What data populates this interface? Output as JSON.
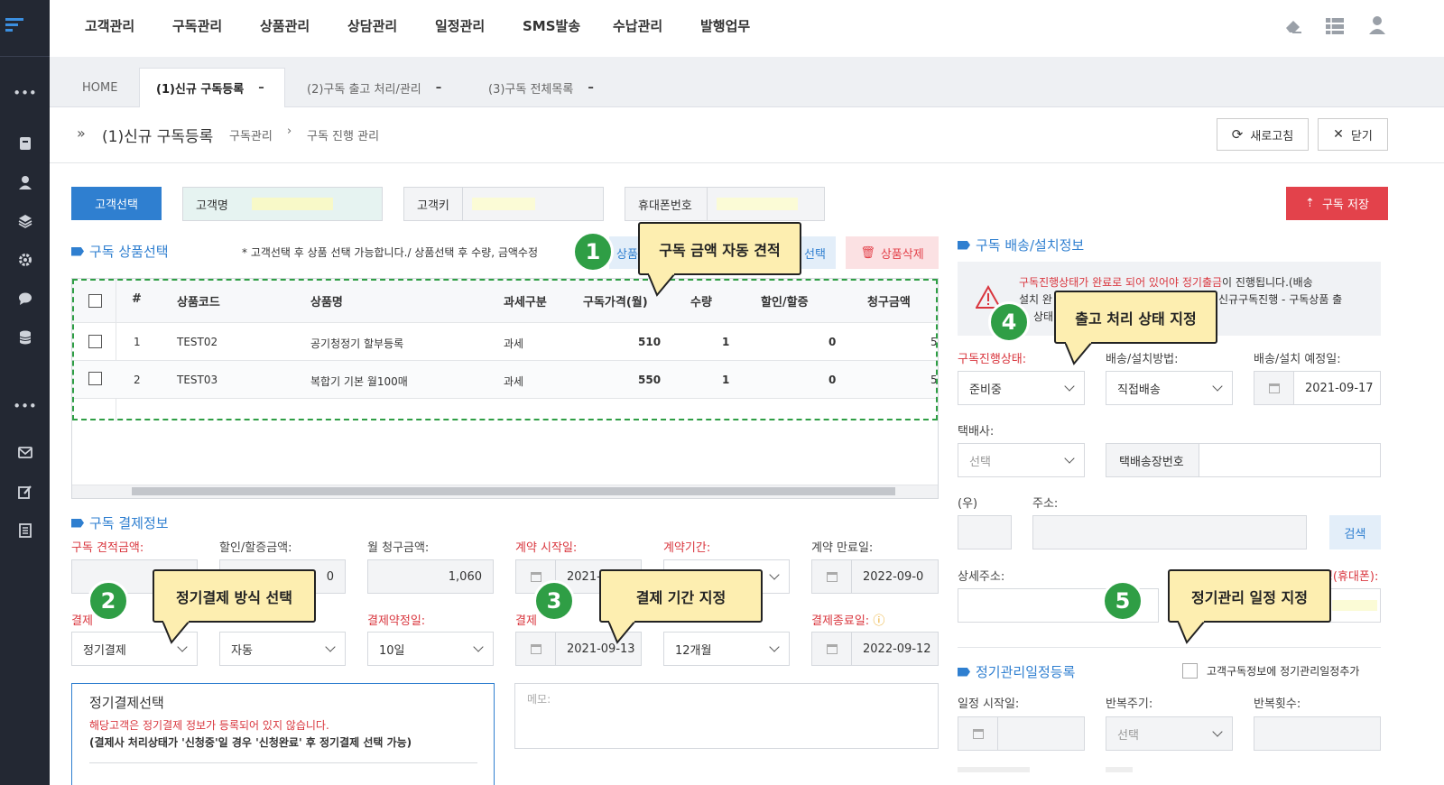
{
  "nav": {
    "menu": [
      "고객관리",
      "구독관리",
      "상품관리",
      "상담관리",
      "일정관리",
      "SMS발송",
      "수납관리",
      "발행업무"
    ]
  },
  "tabs": {
    "home": "HOME",
    "items": [
      {
        "label": "(1)신규 구독등록",
        "close": "–"
      },
      {
        "label": "(2)구독 출고 처리/관리",
        "close": "–"
      },
      {
        "label": "(3)구독 전체목록",
        "close": "–"
      }
    ]
  },
  "page": {
    "title": "(1)신규 구독등록",
    "breadcrumb": [
      "구독관리",
      "구독 진행 관리"
    ],
    "refresh": "새로고침",
    "close": "닫기",
    "save": "구독 저장"
  },
  "customer": {
    "select_btn": "고객선택",
    "name_label": "고객명",
    "key_label": "고객키",
    "phone_label": "휴대폰번호"
  },
  "products": {
    "section": "구독 상품선택",
    "note": "* 고객선택 후 상품 선택 가능합니다./ 상품선택 후 수량, 금액수정",
    "add_btn": "상품",
    "select_btn": "선택",
    "delete_btn": "상품삭제",
    "columns": [
      "#",
      "상품코드",
      "상품명",
      "과세구분",
      "구독가격(월)",
      "수량",
      "할인/할증",
      "청구금액"
    ],
    "rows": [
      {
        "no": "1",
        "code": "TEST02",
        "name": "공기청정기 할부등록",
        "tax": "과세",
        "price": "510",
        "qty": "1",
        "disc": "0",
        "amount": "5"
      },
      {
        "no": "2",
        "code": "TEST03",
        "name": "복합기 기본 월100매",
        "tax": "과세",
        "price": "550",
        "qty": "1",
        "disc": "0",
        "amount": "5"
      }
    ]
  },
  "payment": {
    "section": "구독 결제정보",
    "est_label": "구독 견적금액:",
    "disc_label": "할인/할증금액:",
    "disc_value": "0",
    "monthly_label": "월 청구금액:",
    "monthly_value": "1,060",
    "start_label": "계약 시작일:",
    "start_value": "2021-0",
    "period_label": "계약기간:",
    "end_label": "계약 만료일:",
    "end_value": "2022-09-0",
    "method_label": "결제",
    "method_value": "정기결제",
    "auto_value": "자동",
    "payday_label": "결제약정일:",
    "payday_value": "10일",
    "paystart_label": "결제",
    "paystart_value": "2021-09-13",
    "payperiod_value": "12개월",
    "payend_label": "결제종료일:",
    "payend_value": "2022-09-12",
    "box_title": "정기결제선택",
    "box_warn": "해당고객은 정기결제 정보가 등록되어 있지 않습니다.",
    "box_note": "(결제사 처리상태가 '신청중'일 경우 '신청완료' 후 정기결제 선택 가능)",
    "memo_placeholder": "메모:"
  },
  "delivery": {
    "section": "구독 배송/설치정보",
    "warn_red": "구독진행상태가 완료로 되어 있어야 정기출금",
    "warn_rest": "이 진행됩니다.(배송",
    "warn_line2a": "설치 완",
    "warn_line2b": "신규구독진행 - 구독상품 출",
    "warn_line3": "상태",
    "status_label": "구독진행상태:",
    "status_value": "준비중",
    "method_label": "배송/설치방법:",
    "method_value": "직접배송",
    "date_label": "배송/설치 예정일:",
    "date_value": "2021-09-17",
    "courier_label": "택배사:",
    "courier_value": "선택",
    "tracking_label": "택배송장번호",
    "zip_label": "(우)",
    "addr_label": "주소:",
    "search_btn": "검색",
    "detail_label": "상세주소:",
    "recv_label": "일정(휴대폰):"
  },
  "schedule": {
    "section": "정기관리일정등록",
    "add_check": "고객구독정보에 정기관리일정추가",
    "start_label": "일정 시작일:",
    "cycle_label": "반복주기:",
    "cycle_value": "선택",
    "count_label": "반복횟수:"
  },
  "callouts": [
    {
      "n": "1",
      "text": "구독 금액 자동 견적"
    },
    {
      "n": "2",
      "text": "정기결제 방식 선택"
    },
    {
      "n": "3",
      "text": "결제 기간 지정"
    },
    {
      "n": "4",
      "text": "출고 처리 상태 지정"
    },
    {
      "n": "5",
      "text": "정기관리 일정 지정"
    }
  ],
  "icons": [
    "menu-icon",
    "more-icon",
    "book-icon",
    "user-icon",
    "layers-icon",
    "gear-icon",
    "chat-icon",
    "database-icon",
    "mail-icon",
    "edit-icon",
    "document-icon",
    "eraser-icon",
    "list-icon",
    "account-icon"
  ],
  "colors": {
    "primary": "#2f7fd0",
    "danger": "#e3424b",
    "callout": "#fdeeb0",
    "badge": "#2f9e45",
    "sidebar": "#232833"
  }
}
